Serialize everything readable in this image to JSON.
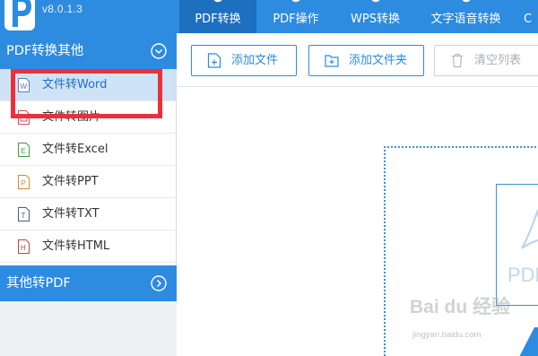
{
  "app": {
    "version": "v8.0.1.3",
    "accent_color": "#2d8be0",
    "accent_dark": "#1d6fbf"
  },
  "nav": {
    "tabs": [
      {
        "label": "PDF转换",
        "active": true,
        "icon": "convert-icon"
      },
      {
        "label": "PDF操作",
        "active": false,
        "icon": "pdf-ops-icon"
      },
      {
        "label": "WPS转换",
        "active": false,
        "icon": "wps-icon"
      },
      {
        "label": "文字语音转换",
        "active": false,
        "icon": "speech-icon"
      },
      {
        "label": "C",
        "active": false,
        "icon": ""
      }
    ]
  },
  "sidebar": {
    "section1": {
      "title": "PDF转换其他",
      "icon": "chevron-down-circle-icon"
    },
    "items": [
      {
        "label": "文件转Word",
        "icon": "word-file-icon",
        "icon_letter": "W",
        "icon_color": "#5b7fb8",
        "active": true
      },
      {
        "label": "文件转图片",
        "icon": "image-file-icon",
        "icon_letter": "",
        "icon_color": "#d05050",
        "active": false
      },
      {
        "label": "文件转Excel",
        "icon": "excel-file-icon",
        "icon_letter": "E",
        "icon_color": "#3f9a45",
        "active": false
      },
      {
        "label": "文件转PPT",
        "icon": "ppt-file-icon",
        "icon_letter": "P",
        "icon_color": "#d58a2e",
        "active": false
      },
      {
        "label": "文件转TXT",
        "icon": "txt-file-icon",
        "icon_letter": "T",
        "icon_color": "#4f5d6b",
        "active": false
      },
      {
        "label": "文件转HTML",
        "icon": "html-file-icon",
        "icon_letter": "H",
        "icon_color": "#c0463f",
        "active": false
      }
    ],
    "section2": {
      "title": "其他转PDF",
      "icon": "chevron-right-circle-icon"
    }
  },
  "toolbar": {
    "add_file_label": "添加文件",
    "add_folder_label": "添加文件夹",
    "clear_label": "清空列表"
  },
  "main": {
    "pdf_card_text": "PDF"
  },
  "watermark": {
    "text": "Bai du 经验",
    "url": "jingyan.baidu.com"
  }
}
